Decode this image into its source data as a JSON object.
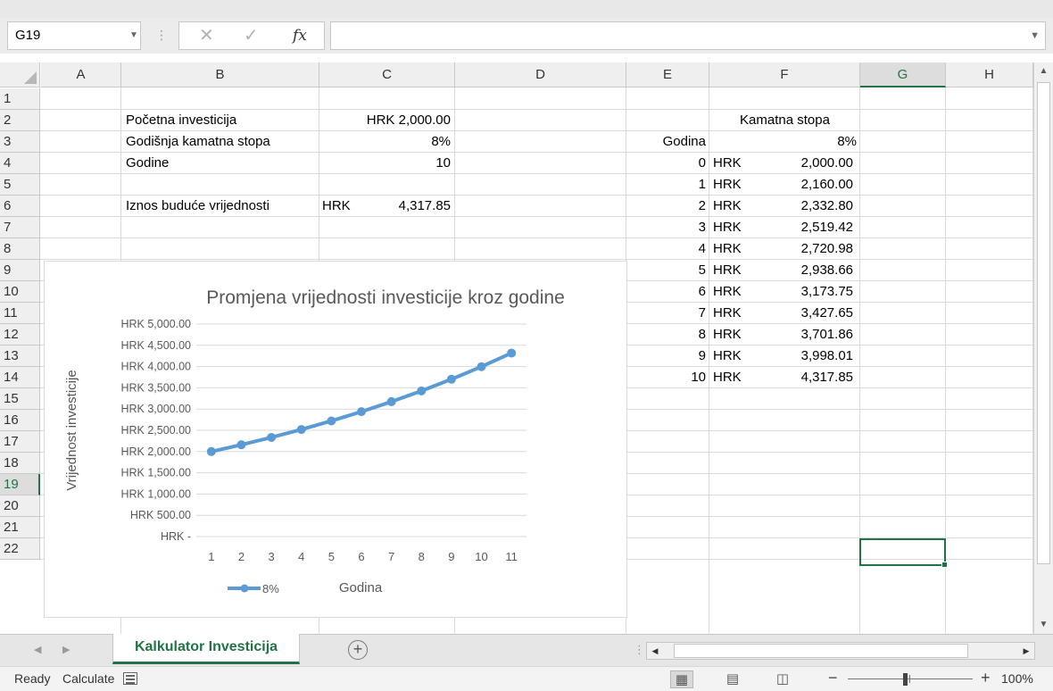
{
  "formula_bar": {
    "name_box": "G19",
    "formula": ""
  },
  "columns": [
    "A",
    "B",
    "C",
    "D",
    "E",
    "F",
    "G",
    "H"
  ],
  "rows": [
    "1",
    "2",
    "3",
    "4",
    "5",
    "6",
    "7",
    "8",
    "9",
    "10",
    "11",
    "12",
    "13",
    "14",
    "15",
    "16",
    "17",
    "18",
    "19",
    "20",
    "21",
    "22"
  ],
  "selected": {
    "col": "G",
    "row": "19"
  },
  "inputs": {
    "initial_label": "Početna investicija",
    "initial_value": "HRK 2,000.00",
    "rate_label": "Godišnja kamatna stopa",
    "rate_value": "8%",
    "years_label": "Godine",
    "years_value": "10",
    "fv_label": "Iznos buduće vrijednosti",
    "fv_currency": "HRK",
    "fv_value": "4,317.85"
  },
  "table": {
    "header_rate_label": "Kamatna stopa",
    "header_year_label": "Godina",
    "header_rate_value": "8%",
    "currency": "HRK",
    "rows": [
      {
        "year": "0",
        "value": "2,000.00"
      },
      {
        "year": "1",
        "value": "2,160.00"
      },
      {
        "year": "2",
        "value": "2,332.80"
      },
      {
        "year": "3",
        "value": "2,519.42"
      },
      {
        "year": "4",
        "value": "2,720.98"
      },
      {
        "year": "5",
        "value": "2,938.66"
      },
      {
        "year": "6",
        "value": "3,173.75"
      },
      {
        "year": "7",
        "value": "3,427.65"
      },
      {
        "year": "8",
        "value": "3,701.86"
      },
      {
        "year": "9",
        "value": "3,998.01"
      },
      {
        "year": "10",
        "value": "4,317.85"
      }
    ]
  },
  "chart_data": {
    "type": "line",
    "title": "Promjena vrijednosti investicije kroz godine",
    "xlabel": "Godina",
    "ylabel": "Vrijednost investicije",
    "categories": [
      "1",
      "2",
      "3",
      "4",
      "5",
      "6",
      "7",
      "8",
      "9",
      "10",
      "11"
    ],
    "y_ticks": [
      0,
      500,
      1000,
      1500,
      2000,
      2500,
      3000,
      3500,
      4000,
      4500,
      5000
    ],
    "y_tick_labels": [
      "HRK -",
      "HRK 500.00",
      "HRK 1,000.00",
      "HRK 1,500.00",
      "HRK 2,000.00",
      "HRK 2,500.00",
      "HRK 3,000.00",
      "HRK 3,500.00",
      "HRK 4,000.00",
      "HRK 4,500.00",
      "HRK 5,000.00"
    ],
    "ylim": [
      0,
      5000
    ],
    "series": [
      {
        "name": "8%",
        "color": "#5b9bd5",
        "values": [
          2000.0,
          2160.0,
          2332.8,
          2519.42,
          2720.98,
          2938.66,
          3173.75,
          3427.65,
          3701.86,
          3998.01,
          4317.85
        ]
      }
    ],
    "legend": "bottom-left",
    "grid": true
  },
  "sheet_tabs": {
    "active": "Kalkulator Investicija",
    "add_symbol": "+"
  },
  "status_bar": {
    "ready": "Ready",
    "calculate": "Calculate",
    "zoom": "100%"
  },
  "colors": {
    "accent": "#217346",
    "series": "#5b9bd5"
  }
}
